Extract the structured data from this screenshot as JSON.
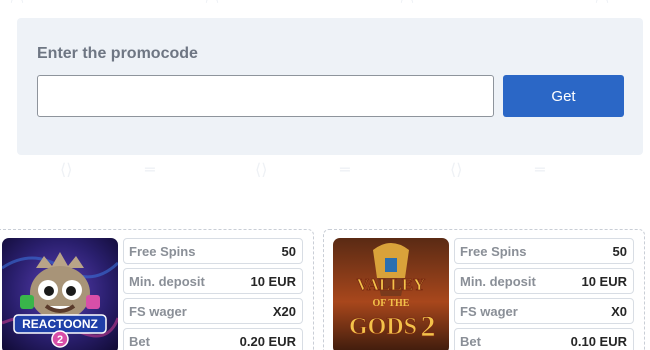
{
  "promo": {
    "title": "Enter the promocode",
    "input_value": "",
    "input_placeholder": "",
    "button_label": "Get"
  },
  "offers": [
    {
      "game": "Reactoonz 2",
      "rows": [
        {
          "label": "Free Spins",
          "value": "50"
        },
        {
          "label": "Min. deposit",
          "value": "10 EUR"
        },
        {
          "label": "FS wager",
          "value": "X20"
        },
        {
          "label": "Bet",
          "value": "0.20 EUR"
        }
      ]
    },
    {
      "game": "Valley of the Gods 2",
      "rows": [
        {
          "label": "Free Spins",
          "value": "50"
        },
        {
          "label": "Min. deposit",
          "value": "10 EUR"
        },
        {
          "label": "FS wager",
          "value": "X0"
        },
        {
          "label": "Bet",
          "value": "0.10 EUR"
        }
      ]
    }
  ],
  "colors": {
    "accent": "#2b67c6",
    "panel_bg": "#eef2f7"
  }
}
